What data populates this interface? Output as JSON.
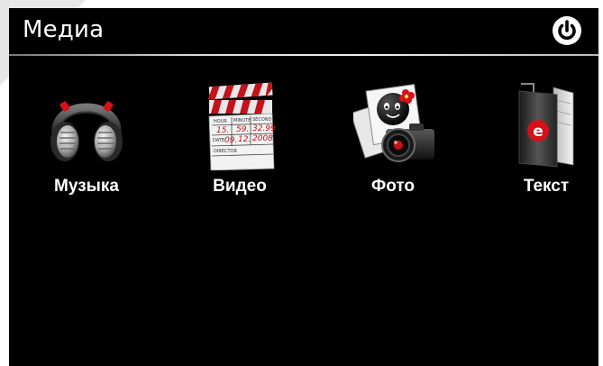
{
  "header": {
    "title": "Медиа"
  },
  "power": {
    "icon": "power-icon"
  },
  "menu": [
    {
      "label": "Музыка",
      "icon": "headphones-icon"
    },
    {
      "label": "Видео",
      "icon": "clapperboard-icon"
    },
    {
      "label": "Фото",
      "icon": "camera-photo-icon"
    },
    {
      "label": "Текст",
      "icon": "ebook-icon"
    }
  ],
  "clapperboard": {
    "hour_label": "HOUR",
    "minute_label": "MINUTE",
    "second_label": "SECOND",
    "hour": "15.",
    "minute": "59.",
    "second": "32.99",
    "date_label": "DATE",
    "day": "09.",
    "month": "12.",
    "year": "2008",
    "director_label": "DIRECTOR"
  },
  "ebook": {
    "badge_letter": "e"
  },
  "colors": {
    "background": "#000000",
    "text": "#ffffff",
    "accent": "#d4121a"
  }
}
